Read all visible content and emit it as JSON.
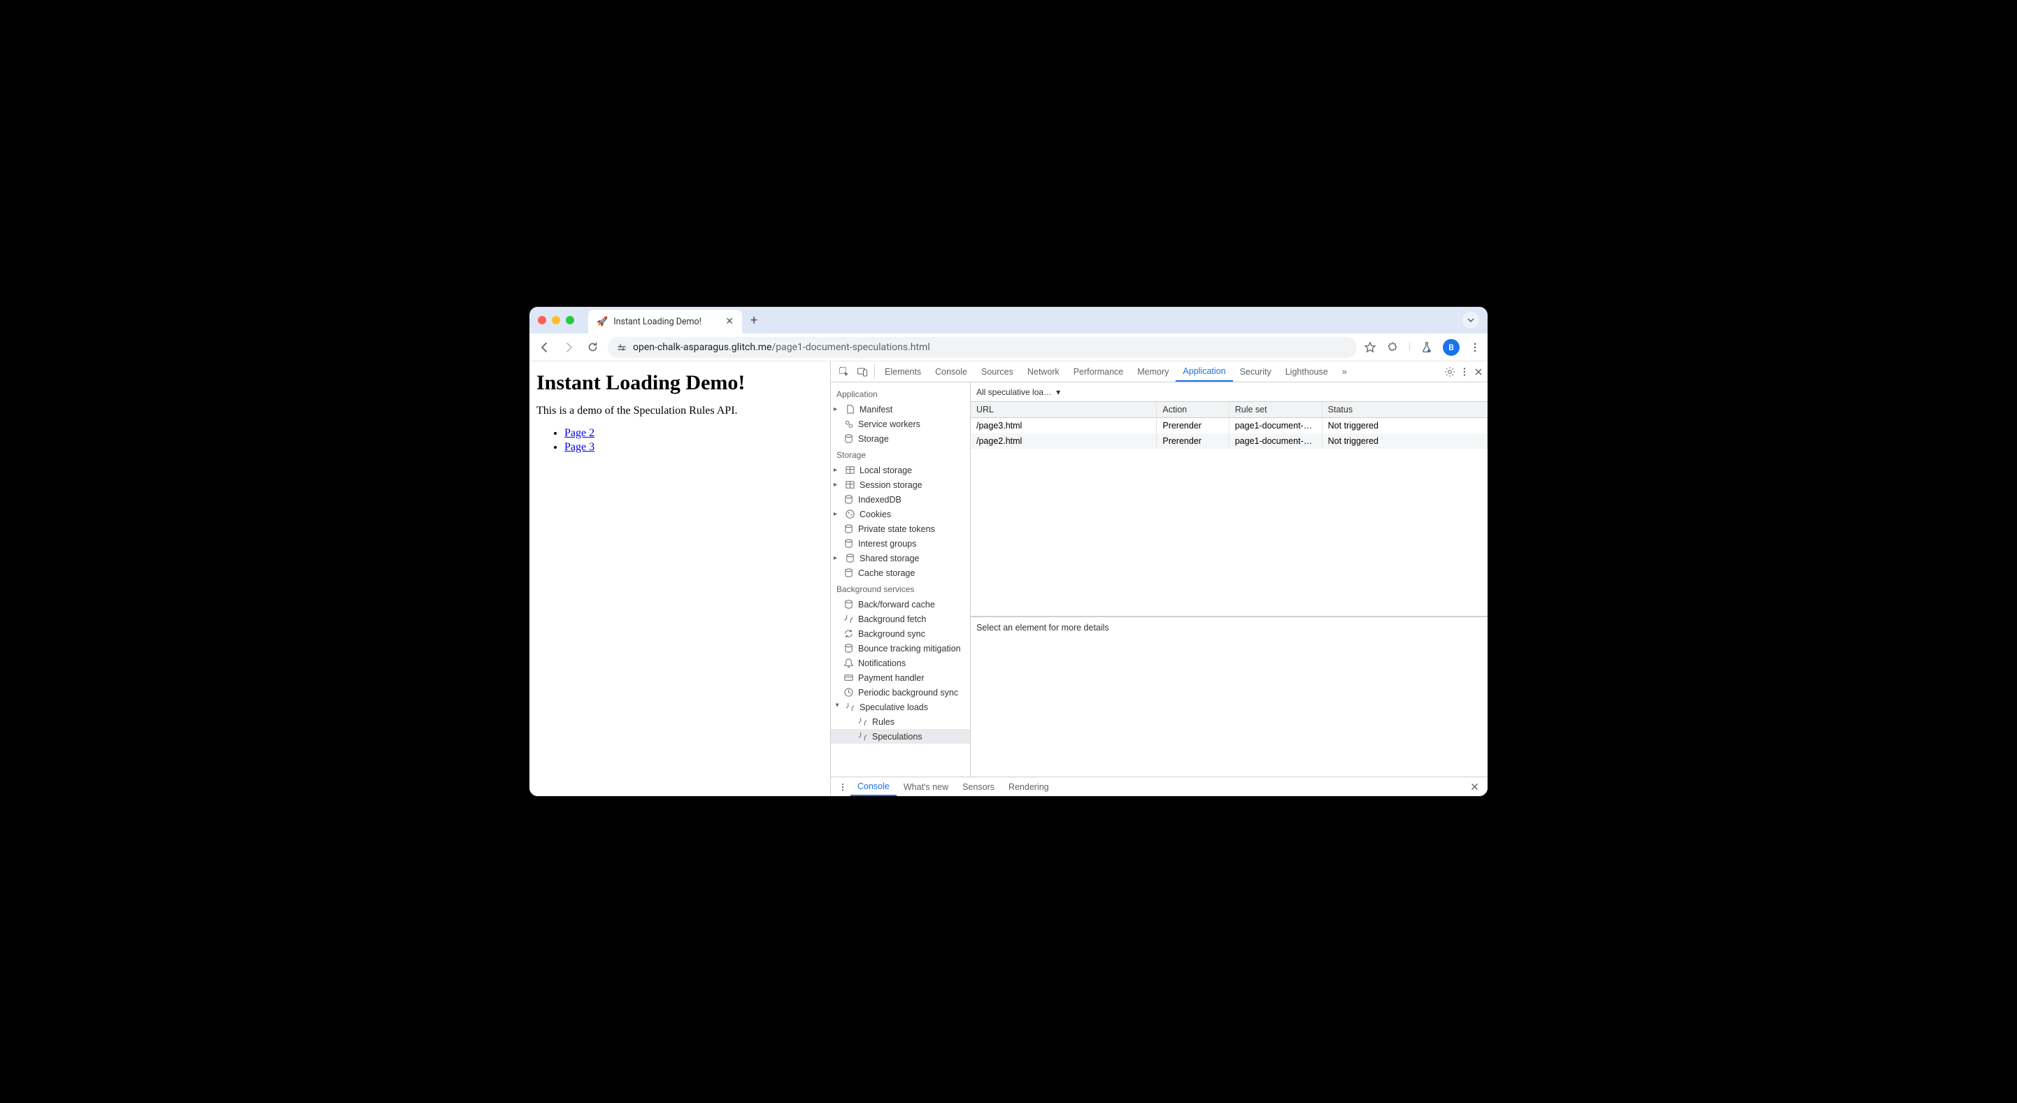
{
  "browser": {
    "tab_emoji": "🚀",
    "tab_title": "Instant Loading Demo!",
    "url_host": "open-chalk-asparagus.glitch.me",
    "url_path": "/page1-document-speculations.html",
    "avatar_letter": "B"
  },
  "page": {
    "heading": "Instant Loading Demo!",
    "paragraph": "This is a demo of the Speculation Rules API.",
    "links": [
      "Page 2",
      "Page 3"
    ]
  },
  "devtools": {
    "tabs": [
      "Elements",
      "Console",
      "Sources",
      "Network",
      "Performance",
      "Memory",
      "Application",
      "Security",
      "Lighthouse"
    ],
    "active_tab": "Application",
    "more": "»",
    "sidebar": {
      "application": {
        "label": "Application",
        "items": [
          "Manifest",
          "Service workers",
          "Storage"
        ]
      },
      "storage": {
        "label": "Storage",
        "items": [
          "Local storage",
          "Session storage",
          "IndexedDB",
          "Cookies",
          "Private state tokens",
          "Interest groups",
          "Shared storage",
          "Cache storage"
        ]
      },
      "background": {
        "label": "Background services",
        "items": [
          "Back/forward cache",
          "Background fetch",
          "Background sync",
          "Bounce tracking mitigation",
          "Notifications",
          "Payment handler",
          "Periodic background sync",
          "Speculative loads"
        ],
        "spec_children": [
          "Rules",
          "Speculations"
        ],
        "selected": "Speculations"
      }
    },
    "filter_label": "All speculative loa…",
    "table": {
      "headers": [
        "URL",
        "Action",
        "Rule set",
        "Status"
      ],
      "rows": [
        {
          "url": "/page3.html",
          "action": "Prerender",
          "ruleset": "page1-document-…",
          "status": "Not triggered"
        },
        {
          "url": "/page2.html",
          "action": "Prerender",
          "ruleset": "page1-document-…",
          "status": "Not triggered"
        }
      ]
    },
    "detail_placeholder": "Select an element for more details",
    "drawer": {
      "tabs": [
        "Console",
        "What's new",
        "Sensors",
        "Rendering"
      ],
      "active": "Console"
    }
  }
}
